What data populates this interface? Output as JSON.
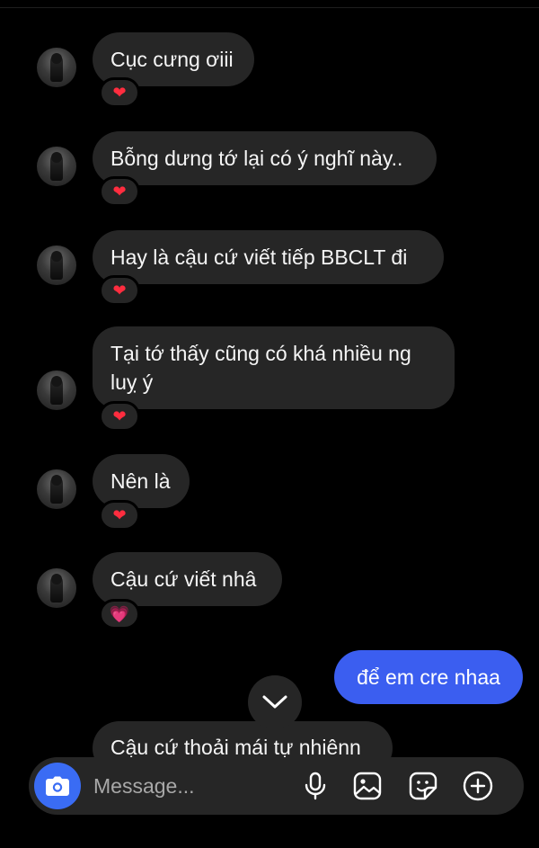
{
  "messages_received": [
    {
      "text": "Cục cưng ơiii",
      "reaction": "❤"
    },
    {
      "text": "Bỗng dưng tớ lại có ý nghĩ này..",
      "reaction": "❤"
    },
    {
      "text": "Hay là cậu cứ viết tiếp BBCLT đi",
      "reaction": "❤"
    },
    {
      "text": "Tại tớ thấy cũng có khá nhiều ng luỵ ý",
      "reaction": "❤"
    },
    {
      "text": "Nên là",
      "reaction": "❤"
    },
    {
      "text": "Cậu cứ viết nhâ",
      "reaction": "💗"
    }
  ],
  "message_sent": {
    "text": "để em cre nhaa"
  },
  "message_partial": {
    "text": "Cậu cứ thoải mái tự nhiênn"
  },
  "composer": {
    "placeholder": "Message...",
    "icons": [
      "camera-icon",
      "microphone-icon",
      "gallery-icon",
      "sticker-icon",
      "plus-icon"
    ]
  },
  "colors": {
    "background": "#000000",
    "received_bubble": "#262626",
    "sent_bubble": "#3b5ef0",
    "camera_button": "#3a6cf4",
    "heart_red": "#ff2d3f",
    "heart_pink": "#f06bb5"
  }
}
